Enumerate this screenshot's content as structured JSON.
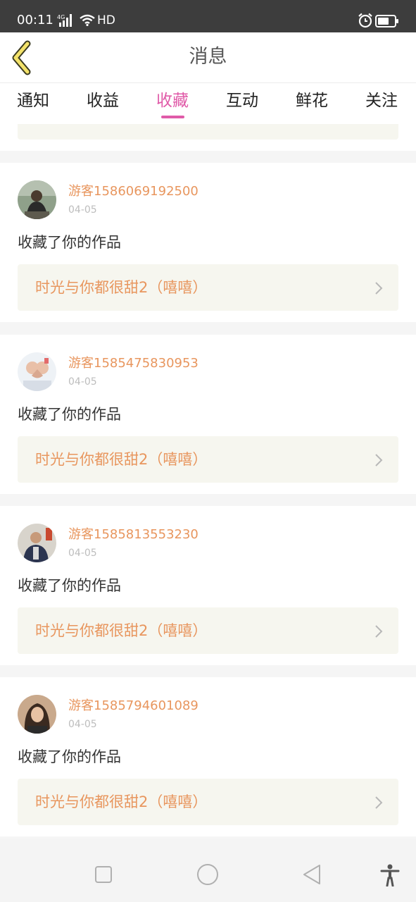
{
  "status_bar": {
    "time": "00:11",
    "network": "4G",
    "hd": "HD",
    "alarm_icon": "alarm-clock-icon",
    "battery_icon": "battery-icon"
  },
  "header": {
    "title": "消息",
    "back_icon": "chevron-left-icon"
  },
  "tabs": [
    {
      "label": "通知",
      "active": false
    },
    {
      "label": "收益",
      "active": false
    },
    {
      "label": "收藏",
      "active": true
    },
    {
      "label": "互动",
      "active": false
    },
    {
      "label": "鲜花",
      "active": false
    },
    {
      "label": "关注",
      "active": false
    }
  ],
  "notifications": [
    {
      "username": "游客1586069192500",
      "date": "04-05",
      "action": "收藏了你的作品",
      "work_title": "时光与你都很甜2（嘻嘻）"
    },
    {
      "username": "游客1585475830953",
      "date": "04-05",
      "action": "收藏了你的作品",
      "work_title": "时光与你都很甜2（嘻嘻）"
    },
    {
      "username": "游客1585813553230",
      "date": "04-05",
      "action": "收藏了你的作品",
      "work_title": "时光与你都很甜2（嘻嘻）"
    },
    {
      "username": "游客1585794601089",
      "date": "04-05",
      "action": "收藏了你的作品",
      "work_title": "时光与你都很甜2（嘻嘻）"
    }
  ],
  "colors": {
    "accent": "#e05aa8",
    "username": "#e8965e",
    "work_bg": "#f6f6ef"
  },
  "nav_bar": {
    "recent_icon": "square-icon",
    "home_icon": "circle-icon",
    "back_icon": "triangle-back-icon",
    "accessibility_icon": "accessibility-icon"
  }
}
